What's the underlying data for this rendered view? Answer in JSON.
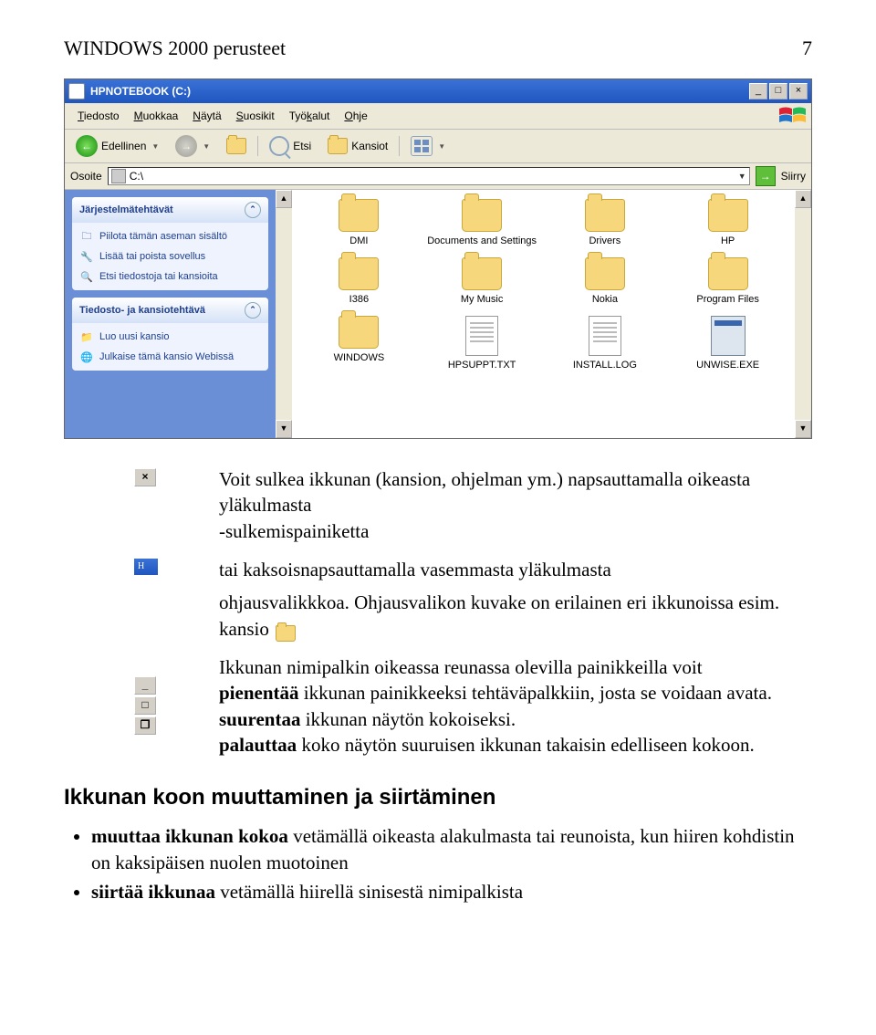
{
  "header": {
    "title": "WINDOWS 2000 perusteet",
    "page": "7"
  },
  "win": {
    "title": "HPNOTEBOOK (C:)",
    "menu": [
      "Tiedosto",
      "Muokkaa",
      "Näytä",
      "Suosikit",
      "Työkalut",
      "Ohje"
    ],
    "toolbar": {
      "back": "Edellinen",
      "search": "Etsi",
      "folders": "Kansiot"
    },
    "addr": {
      "label": "Osoite",
      "path": "C:\\",
      "go": "Siirry"
    },
    "tasks1": {
      "title": "Järjestelmätehtävät",
      "items": [
        "Piilota tämän aseman sisältö",
        "Lisää tai poista sovellus",
        "Etsi tiedostoja tai kansioita"
      ]
    },
    "tasks2": {
      "title": "Tiedosto- ja kansiotehtävä",
      "items": [
        "Luo uusi kansio",
        "Julkaise tämä kansio Webissä"
      ]
    },
    "items": [
      {
        "n": "DMI",
        "t": "f"
      },
      {
        "n": "Documents and Settings",
        "t": "f"
      },
      {
        "n": "Drivers",
        "t": "f"
      },
      {
        "n": "HP",
        "t": "f"
      },
      {
        "n": "I386",
        "t": "f"
      },
      {
        "n": "My Music",
        "t": "f"
      },
      {
        "n": "Nokia",
        "t": "f"
      },
      {
        "n": "Program Files",
        "t": "f"
      },
      {
        "n": "WINDOWS",
        "t": "f"
      },
      {
        "n": "HPSUPPT.TXT",
        "t": "d"
      },
      {
        "n": "INSTALL.LOG",
        "t": "d"
      },
      {
        "n": "UNWISE.EXE",
        "t": "e"
      }
    ]
  },
  "t": {
    "p1a": "Voit sulkea ikkunan (kansion, ohjelman ym.) napsauttamalla oikeasta yläkulmasta",
    "p1b": "-sulkemispainiketta",
    "p2a": "tai  kaksoisnapsauttamalla vasemmasta yläkulmasta",
    "p2b": "ohjausvalikkkoa. Ohjausvalikon kuvake on erilainen eri ikkunoissa esim.",
    "p2c": "kansio",
    "p3": "Ikkunan nimipalkin oikeassa reunassa olevilla painikkeilla voit",
    "p3b": "pienentää",
    "p3c": " ikkunan painikkeeksi tehtäväpalkkiin, josta se voidaan avata.",
    "p4b": "suurentaa",
    "p4c": " ikkunan näytön kokoiseksi.",
    "p5b": "palauttaa",
    "p5c": " koko näytön suuruisen ikkunan takaisin edelliseen kokoon.",
    "h2": "Ikkunan koon muuttaminen ja siirtäminen",
    "li1a": "muuttaa ikkunan kokoa",
    "li1b": " vetämällä oikeasta alakulmasta tai reunoista, kun hiiren kohdistin on kaksipäisen nuolen muotoinen",
    "li2a": "siirtää ikkunaa",
    "li2b": " vetämällä hiirellä sinisestä nimipalkista"
  }
}
